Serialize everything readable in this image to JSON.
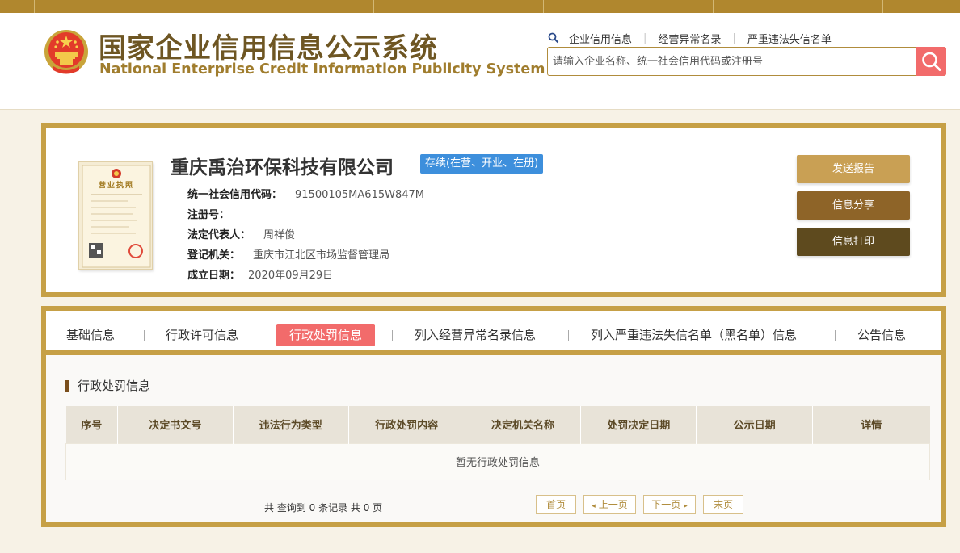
{
  "header": {
    "title_cn": "国家企业信用信息公示系统",
    "title_en": "National Enterprise Credit Information Publicity System",
    "links": [
      {
        "label": "企业信用信息"
      },
      {
        "label": "经营异常名录"
      },
      {
        "label": "严重违法失信名单"
      }
    ],
    "search_placeholder": "请输入企业名称、统一社会信用代码或注册号"
  },
  "license_image": {
    "caption": "营业执照"
  },
  "company": {
    "name": "重庆禹治环保科技有限公司",
    "status": "存续(在营、开业、在册)",
    "fields": [
      {
        "label": "统一社会信用代码：",
        "value": "91500105MA615W847M"
      },
      {
        "label": "注册号：",
        "value": ""
      },
      {
        "label": "法定代表人：",
        "value": "周祥俊"
      },
      {
        "label": "登记机关：",
        "value": "重庆市江北区市场监督管理局"
      },
      {
        "label": "成立日期：",
        "value": "2020年09月29日"
      }
    ]
  },
  "actions": {
    "send_report": "发送报告",
    "share": "信息分享",
    "print": "信息打印"
  },
  "colors": {
    "gold_border": "#c6a046",
    "top_strip": "#b0872e",
    "title_brown": "#6e5623",
    "accent_red": "#f26b6b",
    "status_blue": "#3d8fdc",
    "btn_send": "#c9a054",
    "btn_share": "#8e6428",
    "btn_print": "#5e4a1e"
  },
  "tabs": [
    {
      "label": "基础信息"
    },
    {
      "label": "行政许可信息"
    },
    {
      "label": "行政处罚信息"
    },
    {
      "label": "列入经营异常名录信息"
    },
    {
      "label": "列入严重违法失信名单（黑名单）信息"
    },
    {
      "label": "公告信息"
    }
  ],
  "active_tab": "行政处罚信息",
  "section": {
    "title": "行政处罚信息",
    "columns": [
      "序号",
      "决定书文号",
      "违法行为类型",
      "行政处罚内容",
      "决定机关名称",
      "处罚决定日期",
      "公示日期",
      "详情"
    ],
    "empty_text": "暂无行政处罚信息"
  },
  "pagination": {
    "summary": "共 查询到 0 条记录 共 0 页",
    "first": "首页",
    "prev": "上一页",
    "next": "下一页",
    "last": "末页"
  },
  "icons": {
    "emblem": "national-emblem-icon",
    "search": "search-icon",
    "magnifier": "small-magnifier-icon",
    "prev": "chevron-left-icon",
    "next": "chevron-right-icon"
  }
}
